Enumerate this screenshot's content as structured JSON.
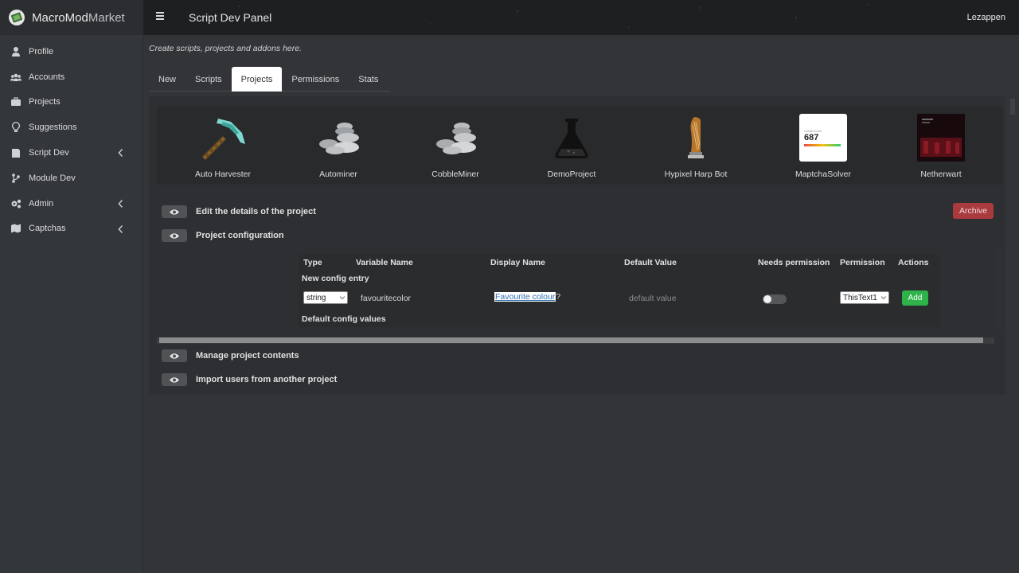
{
  "brand": {
    "name_main": "MacroMod",
    "name_suffix": "Market"
  },
  "sidebar": {
    "items": [
      {
        "label": "Profile",
        "icon": "user-icon",
        "has_chevron": false
      },
      {
        "label": "Accounts",
        "icon": "users-icon",
        "has_chevron": false
      },
      {
        "label": "Projects",
        "icon": "briefcase-icon",
        "has_chevron": false
      },
      {
        "label": "Suggestions",
        "icon": "lightbulb-icon",
        "has_chevron": false
      },
      {
        "label": "Script Dev",
        "icon": "book-icon",
        "has_chevron": true
      },
      {
        "label": "Module Dev",
        "icon": "branch-icon",
        "has_chevron": false
      },
      {
        "label": "Admin",
        "icon": "gears-icon",
        "has_chevron": true
      },
      {
        "label": "Captchas",
        "icon": "map-icon",
        "has_chevron": true
      }
    ]
  },
  "header": {
    "title": "Script Dev Panel",
    "user": "Lezappen"
  },
  "page": {
    "subtitle": "Create scripts, projects and addons here."
  },
  "tabs": [
    {
      "label": "New",
      "active": false
    },
    {
      "label": "Scripts",
      "active": false
    },
    {
      "label": "Projects",
      "active": true
    },
    {
      "label": "Permissions",
      "active": false
    },
    {
      "label": "Stats",
      "active": false
    }
  ],
  "projects": [
    {
      "name": "Auto Harvester",
      "icon": "pickaxe-icon"
    },
    {
      "name": "Autominer",
      "icon": "stones-icon"
    },
    {
      "name": "CobbleMiner",
      "icon": "stones-icon"
    },
    {
      "name": "DemoProject",
      "icon": "flask-icon"
    },
    {
      "name": "Hypixel Harp Bot",
      "icon": "harp-icon"
    },
    {
      "name": "MaptchaSolver",
      "icon": "score-card-icon",
      "thumb_number": "687"
    },
    {
      "name": "Netherwart",
      "icon": "netherwart-thumbnail"
    }
  ],
  "sections": {
    "edit_details": "Edit the details of the project",
    "project_config": "Project configuration",
    "manage_contents": "Manage project contents",
    "import_users": "Import users from another project",
    "archive_label": "Archive"
  },
  "config_table": {
    "headers": {
      "type": "Type",
      "variable": "Variable Name",
      "display": "Display Name",
      "default": "Default Value",
      "needs_permission": "Needs permission",
      "permission": "Permission",
      "actions": "Actions"
    },
    "new_entry_label": "New config entry",
    "new_entry": {
      "type": "string",
      "variable_name": "favouritecolor",
      "display_name_selected": "Favourite colour",
      "display_name_rest": "?",
      "default_placeholder": "default value",
      "needs_permission": false,
      "permission": "ThisText1",
      "add_label": "Add"
    },
    "defaults_label": "Default config values"
  },
  "colors": {
    "accent_add": "#2eb24a",
    "accent_archive": "#a93a3e",
    "sidebar_bg": "#34373a",
    "header_bg": "#1e1f21"
  }
}
